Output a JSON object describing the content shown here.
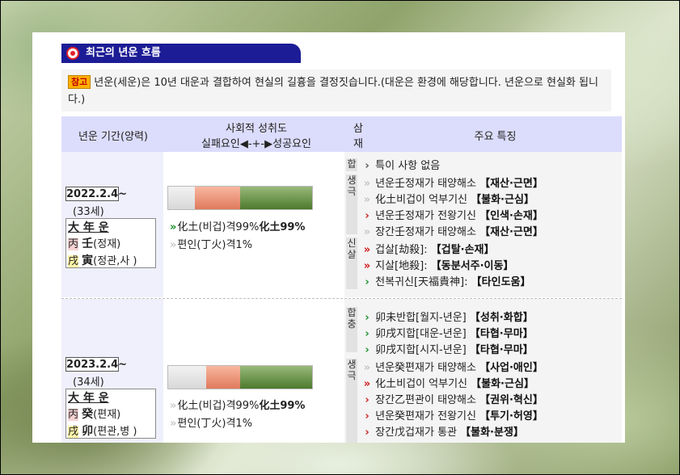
{
  "section_title": "최근의 년운 흐름",
  "note": {
    "badge": "참고",
    "text": "년운(세운)은 10년 대운과 결합하여 현실의 길흉을 결정짓습니다.(대운은 환경에 해당합니다. 년운으로 현실화 됩니다.)"
  },
  "table": {
    "headers": {
      "period": "년운 기간(양력)",
      "social_line1": "사회적 성취도",
      "social_line2": "실패요인◀-+-▶성공요인",
      "samjae_line1": "삼",
      "samjae_line2": "재",
      "features": "주요 특징"
    }
  },
  "rows": [
    {
      "date": "2022.2.4~",
      "age": "(33세)",
      "daeun": "大 年 운",
      "stem_char": "丙",
      "stem_hanja": "壬",
      "stem_label": "(정재)",
      "branch_char": "戌",
      "branch_hanja": "寅",
      "branch_label": "(정관,사 )",
      "achievement": {
        "fail": 0.18,
        "mid": 0.31,
        "success": 0.49
      },
      "line1": "化土(비겁)격99%",
      "line1_bold": "化土99%",
      "line2": "편인(丁火)격1%",
      "cats": {
        "hap": "합",
        "saenggeuk": "생극",
        "sinsal": "신살"
      },
      "features": [
        {
          "text": "특이 사항 없음",
          "tag": ""
        },
        {
          "text": "년운壬정재가 태양해소",
          "tag": "【재산·근면】"
        },
        {
          "text": "化土비겁이 억부기신",
          "tag": "【불화·근심】"
        },
        {
          "text": "년운壬정재가 전왕기신",
          "tag": "【인색·손재】"
        },
        {
          "text": "장간壬정재가 태양해소",
          "tag": "【재산·근면】"
        },
        {
          "text": "겁살[劫殺]:",
          "tag": "【겁탈·손재】"
        },
        {
          "text": "지살[地殺]:",
          "tag": "【동분서주·이동】"
        },
        {
          "text": "천복귀신[天福貴神]:",
          "tag": "【타인도움】"
        }
      ]
    },
    {
      "date": "2023.2.4~",
      "age": "(34세)",
      "daeun": "大 年 운",
      "stem_char": "丙",
      "stem_hanja": "癸",
      "stem_label": "(편재)",
      "branch_char": "戌",
      "branch_hanja": "卯",
      "branch_label": "(편관,병 )",
      "achievement": {
        "fail": 0.26,
        "mid": 0.23,
        "success": 0.49
      },
      "line1": "化土(비겁)격99%",
      "line1_bold": "化土99%",
      "line2": "편인(丁火)격1%",
      "cats": {
        "hapchung": "합충",
        "saenggeuk": "생극"
      },
      "features": [
        {
          "text": "卯未반합[월지-년운]",
          "tag": "【성취·화합】"
        },
        {
          "text": "卯戌지합[대운-년운]",
          "tag": "【타협·무마】"
        },
        {
          "text": "卯戌지합[시지-년운]",
          "tag": "【타협·무마】"
        },
        {
          "text": "년운癸편재가 태양해소",
          "tag": "【사업·애인】"
        },
        {
          "text": "化土비겁이 억부기신",
          "tag": "【불화·근심】"
        },
        {
          "text": "장간乙편관이 태양해소",
          "tag": "【권위·혁신】"
        },
        {
          "text": "년운癸편재가 전왕기신",
          "tag": "【투기·허영】"
        },
        {
          "text": "장간戊겁재가 통관",
          "tag": "【불화·분쟁】"
        }
      ]
    }
  ]
}
